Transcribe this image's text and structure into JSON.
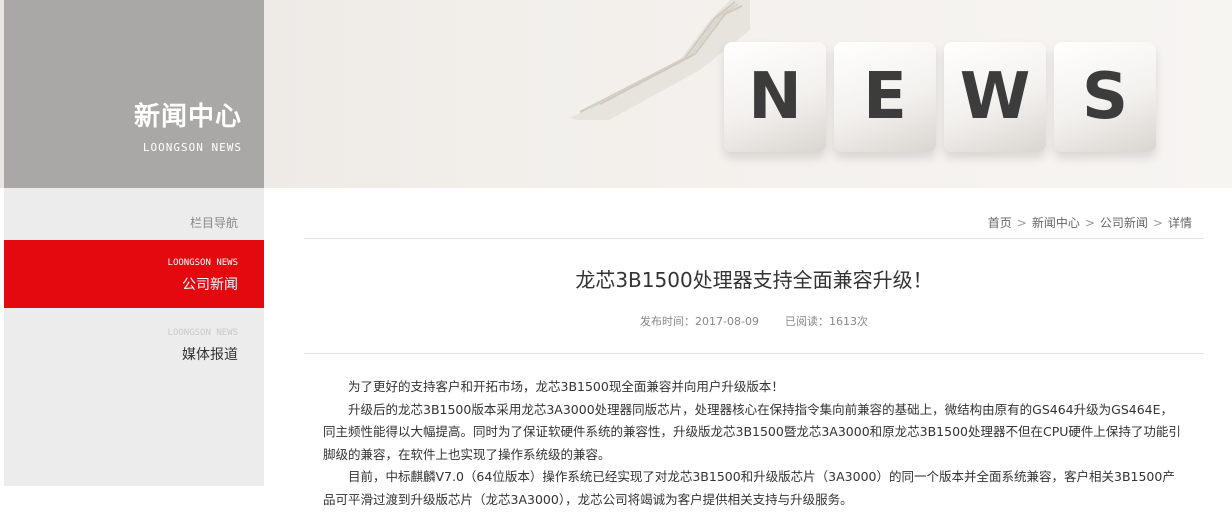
{
  "banner": {
    "title": "新闻中心",
    "subtitle": "LOONGSON NEWS",
    "news_letters": [
      "N",
      "E",
      "W",
      "S"
    ]
  },
  "nav": {
    "heading": "栏目导航",
    "items": [
      {
        "en": "LOONGSON NEWS",
        "label": "公司新闻",
        "active": true
      },
      {
        "en": "LOONGSON NEWS",
        "label": "媒体报道",
        "active": false
      }
    ]
  },
  "breadcrumb": [
    "首页",
    "新闻中心",
    "公司新闻",
    "详情"
  ],
  "article": {
    "title": "龙芯3B1500处理器支持全面兼容升级！",
    "publish_label": "发布时间：2017-08-09",
    "views_label": "已阅读：1613次",
    "paragraphs": [
      "为了更好的支持客户和开拓市场，龙芯3B1500现全面兼容并向用户升级版本！",
      "升级后的龙芯3B1500版本采用龙芯3A3000处理器同版芯片，处理器核心在保持指令集向前兼容的基础上，微结构由原有的GS464升级为GS464E，同主频性能得以大幅提高。同时为了保证软硬件系统的兼容性，升级版龙芯3B1500暨龙芯3A3000和原龙芯3B1500处理器不但在CPU硬件上保持了功能引脚级的兼容，在软件上也实现了操作系统级的兼容。",
      "目前，中标麒麟V7.0（64位版本）操作系统已经实现了对龙芯3B1500和升级版芯片（3A3000）的同一个版本并全面系统兼容，客户相关3B1500产品可平滑过渡到升级版芯片（龙芯3A3000），龙芯公司将竭诚为客户提供相关支持与升级服务。"
    ]
  },
  "colors": {
    "accent": "#e4080f",
    "banner_side": "#a9a8a6",
    "nav_bg": "#ececec"
  }
}
